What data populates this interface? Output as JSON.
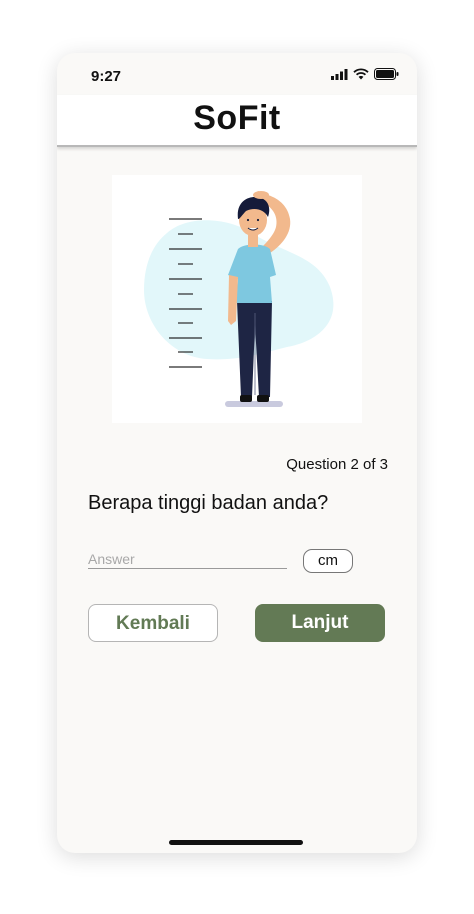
{
  "status": {
    "time": "9:27",
    "icons": [
      "signal-icon",
      "wifi-icon",
      "battery-icon"
    ]
  },
  "header": {
    "title": "SoFit"
  },
  "illustration": {
    "name": "height-measure-illustration",
    "colors": {
      "blob": "#e2f7fa",
      "shirt": "#7ec8e0",
      "pants": "#1e2544",
      "hair": "#151b3a"
    }
  },
  "quiz": {
    "progress": "Question 2 of 3",
    "question": "Berapa tinggi badan anda?",
    "answer_placeholder": "Answer",
    "answer_value": "",
    "unit": "cm"
  },
  "buttons": {
    "back": "Kembali",
    "next": "Lanjut"
  },
  "colors": {
    "accent": "#637a55",
    "background": "#faf9f7"
  }
}
